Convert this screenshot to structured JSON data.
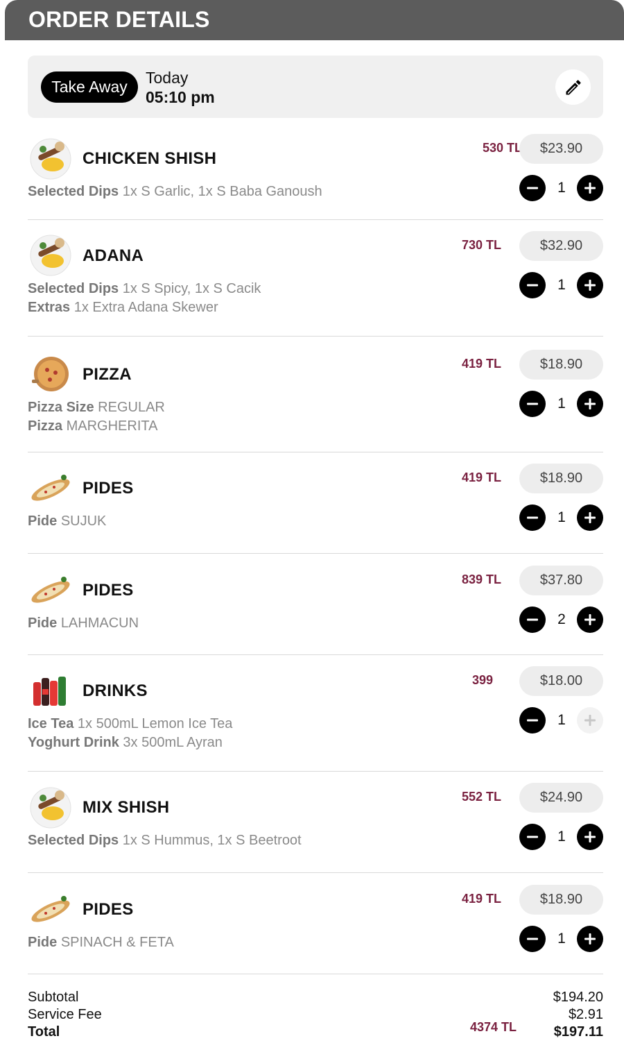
{
  "header": {
    "title": "ORDER DETAILS"
  },
  "order_info": {
    "mode": "Take Away",
    "day": "Today",
    "time": "05:10 pm",
    "edit_icon": "pencil-icon"
  },
  "items": [
    {
      "name": "CHICKEN SHISH",
      "image": "chicken-shish-plate",
      "tl_price": "530 TL",
      "price": "$23.90",
      "qty": "1",
      "plus_enabled": true,
      "mods": [
        {
          "label": "Selected Dips",
          "value": "1x S Garlic, 1x S Baba Ganoush"
        }
      ]
    },
    {
      "name": "ADANA",
      "image": "adana-plate",
      "tl_price": "730 TL",
      "price": "$32.90",
      "qty": "1",
      "plus_enabled": true,
      "mods": [
        {
          "label": "Selected Dips",
          "value": "1x S Spicy, 1x S Cacik"
        },
        {
          "label": "Extras",
          "value": "1x Extra Adana Skewer"
        }
      ]
    },
    {
      "name": "PIZZA",
      "image": "pizza",
      "tl_price": "419 TL",
      "price": "$18.90",
      "qty": "1",
      "plus_enabled": true,
      "mods": [
        {
          "label": "Pizza Size",
          "value": "REGULAR"
        },
        {
          "label": "Pizza",
          "value": "MARGHERITA"
        }
      ]
    },
    {
      "name": "PIDES",
      "image": "pide",
      "tl_price": "419 TL",
      "price": "$18.90",
      "qty": "1",
      "plus_enabled": true,
      "mods": [
        {
          "label": "Pide",
          "value": "SUJUK"
        }
      ]
    },
    {
      "name": "PIDES",
      "image": "pide",
      "tl_price": "839 TL",
      "price": "$37.80",
      "qty": "2",
      "plus_enabled": true,
      "mods": [
        {
          "label": "Pide",
          "value": "LAHMACUN"
        }
      ]
    },
    {
      "name": "DRINKS",
      "image": "drinks-bottles",
      "tl_price": "399",
      "price": "$18.00",
      "qty": "1",
      "plus_enabled": false,
      "mods": [
        {
          "label": "Ice Tea",
          "value": "1x 500mL Lemon Ice Tea"
        },
        {
          "label": "Yoghurt Drink",
          "value": "3x 500mL Ayran"
        }
      ]
    },
    {
      "name": "MIX SHISH",
      "image": "mix-shish-plate",
      "tl_price": "552 TL",
      "price": "$24.90",
      "qty": "1",
      "plus_enabled": true,
      "mods": [
        {
          "label": "Selected Dips",
          "value": "1x S Hummus, 1x S Beetroot"
        }
      ]
    },
    {
      "name": "PIDES",
      "image": "pide",
      "tl_price": "419 TL",
      "price": "$18.90",
      "qty": "1",
      "plus_enabled": true,
      "mods": [
        {
          "label": "Pide",
          "value": "SPINACH & FETA"
        }
      ]
    }
  ],
  "summary": {
    "subtotal_label": "Subtotal",
    "subtotal_value": "$194.20",
    "service_label": "Service Fee",
    "service_value": "$2.91",
    "total_label": "Total",
    "total_value": "$197.11",
    "total_tl": "4374 TL"
  },
  "colors": {
    "header_bg": "#5c5c5c",
    "tl_price": "#7a2140",
    "pill_bg": "#ededed"
  }
}
